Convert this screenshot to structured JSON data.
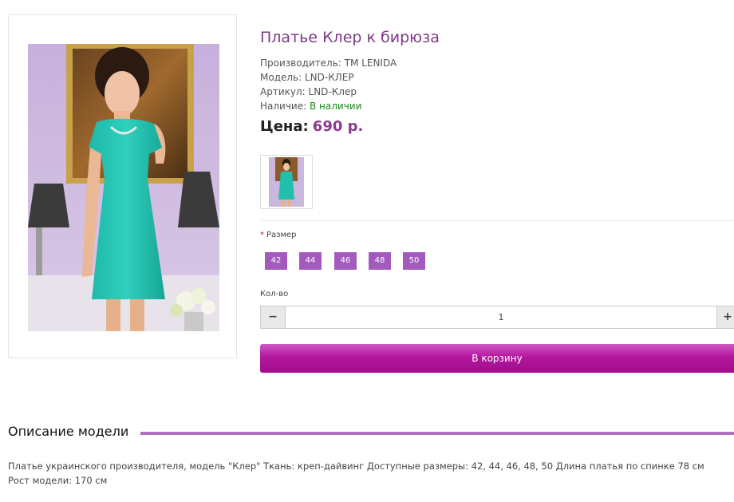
{
  "product": {
    "title": "Платье Клер к бирюза",
    "manufacturer_label": "Производитель:",
    "manufacturer": "TM LENIDA",
    "model_label": "Модель:",
    "model": "LND-КЛЕР",
    "sku_label": "Артикул:",
    "sku": "LND-Клер",
    "availability_label": "Наличие:",
    "availability": "В наличии",
    "price_label": "Цена:",
    "price": "690 р."
  },
  "options": {
    "size_label": "Размер",
    "required_mark": "*",
    "sizes": [
      "42",
      "44",
      "46",
      "48",
      "50"
    ]
  },
  "quantity": {
    "label": "Кол-во",
    "value": "1",
    "minus": "−",
    "plus": "+"
  },
  "cart_button": "В корзину",
  "description": {
    "heading": "Описание модели",
    "text": "Платье украинского производителя, модель \"Клер\" Ткань: креп-дайвинг Доступные размеры: 42, 44, 46, 48, 50 Длина платья по спинке 78 см Рост модели: 170 см"
  },
  "colors": {
    "title": "#7b3a84",
    "price": "#8b3a8f",
    "size_button": "#a25bbd",
    "cart_button": "#b3179f",
    "availability": "#1d8a1d",
    "description_line": "#b36fc0"
  }
}
